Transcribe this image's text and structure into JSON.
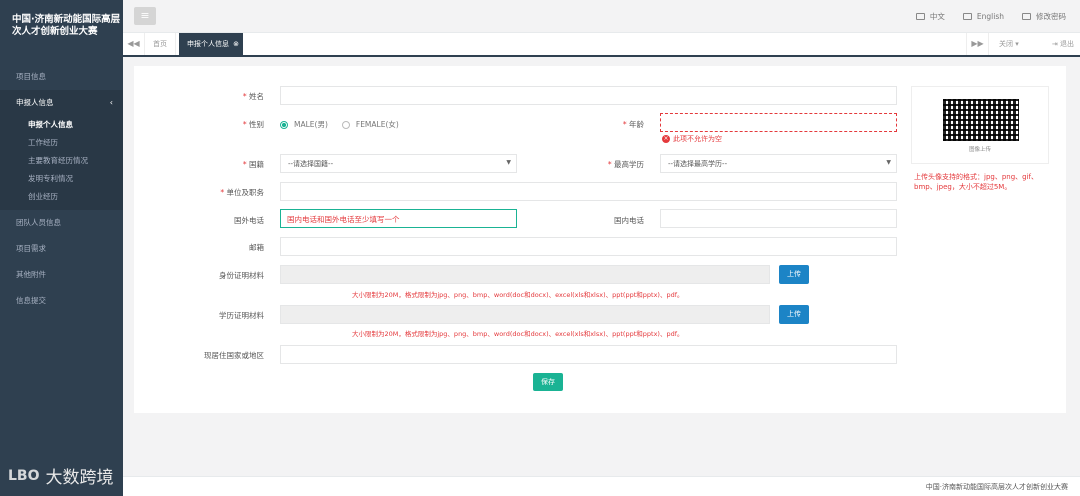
{
  "sidebar": {
    "brand": "中国·济南新动能国际高层次人才创新创业大赛",
    "items": [
      {
        "label": "项目信息"
      },
      {
        "label": "申报人信息",
        "chevron": "‹"
      },
      {
        "label": "团队人员信息"
      },
      {
        "label": "项目需求"
      },
      {
        "label": "其他附件"
      },
      {
        "label": "信息提交"
      }
    ],
    "sub_items": [
      {
        "label": "申报个人信息"
      },
      {
        "label": "工作经历"
      },
      {
        "label": "主要教育经历情况"
      },
      {
        "label": "发明专利情况"
      },
      {
        "label": "创业经历"
      }
    ],
    "watermark_logo": "LBO",
    "watermark_text": "大数跨境"
  },
  "topbar": {
    "menu_icon": "≡",
    "links": [
      {
        "label": "中文"
      },
      {
        "label": "English"
      },
      {
        "label": "修改密码"
      }
    ]
  },
  "tabs": {
    "home": "首页",
    "active": "申报个人信息",
    "close_menu": "关闭 ▾",
    "exit": "⇥ 退出"
  },
  "form": {
    "name_label": "姓名",
    "gender_label": "性别",
    "gender_male": "MALE(男)",
    "gender_female": "FEMALE(女)",
    "age_label": "年龄",
    "age_error": "此项不允许为空",
    "nationality_label": "国籍",
    "nationality_placeholder": "--请选择国籍--",
    "degree_label": "最高学历",
    "degree_placeholder": "--请选择最高学历--",
    "unit_label": "单位及职务",
    "foreign_phone_label": "国外电话",
    "phone_placeholder": "国内电话和国外电话至少填写一个",
    "domestic_phone_label": "国内电话",
    "email_label": "邮箱",
    "id_label": "身份证明材料",
    "edu_label": "学历证明材料",
    "upload_label": "上传",
    "upload_hint": "大小限制为20M，格式限制为jpg、png、bmp、word(doc和docx)、excel(xls和xlsx)、ppt(ppt和pptx)、pdf。",
    "residence_label": "现居住国家或地区",
    "save_label": "保存",
    "qr_caption": "图像上传",
    "photo_hint": "上传头像支持的格式：jpg、png、gif、bmp、jpeg，大小不超过5M。"
  },
  "footer": {
    "text": "中国·济南新动能国际高层次人才创新创业大赛"
  },
  "colors": {
    "sidebar": "#2f4050",
    "accent": "#1ab394",
    "upload": "#1c84c6",
    "error": "#e4393c"
  }
}
